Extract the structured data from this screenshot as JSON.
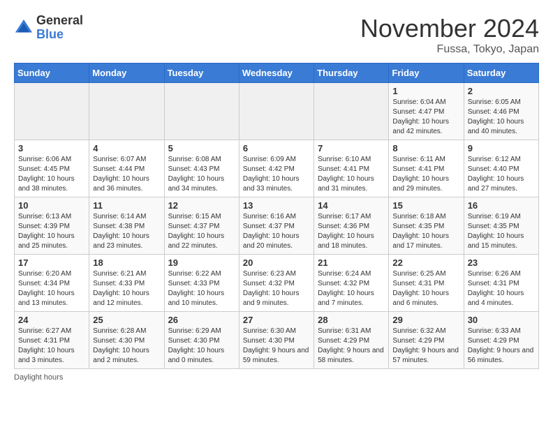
{
  "header": {
    "logo_general": "General",
    "logo_blue": "Blue",
    "month_title": "November 2024",
    "location": "Fussa, Tokyo, Japan"
  },
  "days_of_week": [
    "Sunday",
    "Monday",
    "Tuesday",
    "Wednesday",
    "Thursday",
    "Friday",
    "Saturday"
  ],
  "weeks": [
    [
      {
        "day": "",
        "info": ""
      },
      {
        "day": "",
        "info": ""
      },
      {
        "day": "",
        "info": ""
      },
      {
        "day": "",
        "info": ""
      },
      {
        "day": "",
        "info": ""
      },
      {
        "day": "1",
        "info": "Sunrise: 6:04 AM\nSunset: 4:47 PM\nDaylight: 10 hours and 42 minutes."
      },
      {
        "day": "2",
        "info": "Sunrise: 6:05 AM\nSunset: 4:46 PM\nDaylight: 10 hours and 40 minutes."
      }
    ],
    [
      {
        "day": "3",
        "info": "Sunrise: 6:06 AM\nSunset: 4:45 PM\nDaylight: 10 hours and 38 minutes."
      },
      {
        "day": "4",
        "info": "Sunrise: 6:07 AM\nSunset: 4:44 PM\nDaylight: 10 hours and 36 minutes."
      },
      {
        "day": "5",
        "info": "Sunrise: 6:08 AM\nSunset: 4:43 PM\nDaylight: 10 hours and 34 minutes."
      },
      {
        "day": "6",
        "info": "Sunrise: 6:09 AM\nSunset: 4:42 PM\nDaylight: 10 hours and 33 minutes."
      },
      {
        "day": "7",
        "info": "Sunrise: 6:10 AM\nSunset: 4:41 PM\nDaylight: 10 hours and 31 minutes."
      },
      {
        "day": "8",
        "info": "Sunrise: 6:11 AM\nSunset: 4:41 PM\nDaylight: 10 hours and 29 minutes."
      },
      {
        "day": "9",
        "info": "Sunrise: 6:12 AM\nSunset: 4:40 PM\nDaylight: 10 hours and 27 minutes."
      }
    ],
    [
      {
        "day": "10",
        "info": "Sunrise: 6:13 AM\nSunset: 4:39 PM\nDaylight: 10 hours and 25 minutes."
      },
      {
        "day": "11",
        "info": "Sunrise: 6:14 AM\nSunset: 4:38 PM\nDaylight: 10 hours and 23 minutes."
      },
      {
        "day": "12",
        "info": "Sunrise: 6:15 AM\nSunset: 4:37 PM\nDaylight: 10 hours and 22 minutes."
      },
      {
        "day": "13",
        "info": "Sunrise: 6:16 AM\nSunset: 4:37 PM\nDaylight: 10 hours and 20 minutes."
      },
      {
        "day": "14",
        "info": "Sunrise: 6:17 AM\nSunset: 4:36 PM\nDaylight: 10 hours and 18 minutes."
      },
      {
        "day": "15",
        "info": "Sunrise: 6:18 AM\nSunset: 4:35 PM\nDaylight: 10 hours and 17 minutes."
      },
      {
        "day": "16",
        "info": "Sunrise: 6:19 AM\nSunset: 4:35 PM\nDaylight: 10 hours and 15 minutes."
      }
    ],
    [
      {
        "day": "17",
        "info": "Sunrise: 6:20 AM\nSunset: 4:34 PM\nDaylight: 10 hours and 13 minutes."
      },
      {
        "day": "18",
        "info": "Sunrise: 6:21 AM\nSunset: 4:33 PM\nDaylight: 10 hours and 12 minutes."
      },
      {
        "day": "19",
        "info": "Sunrise: 6:22 AM\nSunset: 4:33 PM\nDaylight: 10 hours and 10 minutes."
      },
      {
        "day": "20",
        "info": "Sunrise: 6:23 AM\nSunset: 4:32 PM\nDaylight: 10 hours and 9 minutes."
      },
      {
        "day": "21",
        "info": "Sunrise: 6:24 AM\nSunset: 4:32 PM\nDaylight: 10 hours and 7 minutes."
      },
      {
        "day": "22",
        "info": "Sunrise: 6:25 AM\nSunset: 4:31 PM\nDaylight: 10 hours and 6 minutes."
      },
      {
        "day": "23",
        "info": "Sunrise: 6:26 AM\nSunset: 4:31 PM\nDaylight: 10 hours and 4 minutes."
      }
    ],
    [
      {
        "day": "24",
        "info": "Sunrise: 6:27 AM\nSunset: 4:31 PM\nDaylight: 10 hours and 3 minutes."
      },
      {
        "day": "25",
        "info": "Sunrise: 6:28 AM\nSunset: 4:30 PM\nDaylight: 10 hours and 2 minutes."
      },
      {
        "day": "26",
        "info": "Sunrise: 6:29 AM\nSunset: 4:30 PM\nDaylight: 10 hours and 0 minutes."
      },
      {
        "day": "27",
        "info": "Sunrise: 6:30 AM\nSunset: 4:30 PM\nDaylight: 9 hours and 59 minutes."
      },
      {
        "day": "28",
        "info": "Sunrise: 6:31 AM\nSunset: 4:29 PM\nDaylight: 9 hours and 58 minutes."
      },
      {
        "day": "29",
        "info": "Sunrise: 6:32 AM\nSunset: 4:29 PM\nDaylight: 9 hours and 57 minutes."
      },
      {
        "day": "30",
        "info": "Sunrise: 6:33 AM\nSunset: 4:29 PM\nDaylight: 9 hours and 56 minutes."
      }
    ]
  ],
  "footer": {
    "daylight_label": "Daylight hours"
  }
}
